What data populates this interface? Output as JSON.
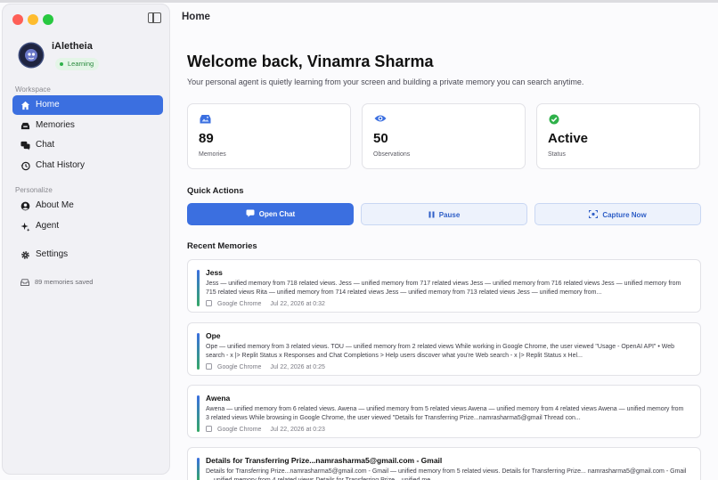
{
  "sidebar": {
    "app_name": "iAletheia",
    "status": "Learning",
    "workspace_label": "Workspace",
    "personalize_label": "Personalize",
    "workspace_items": [
      {
        "label": "Home",
        "icon": "home-icon"
      },
      {
        "label": "Memories",
        "icon": "tray-icon"
      },
      {
        "label": "Chat",
        "icon": "chat-bubbles-icon"
      },
      {
        "label": "Chat History",
        "icon": "history-clock-icon"
      }
    ],
    "personalize_items": [
      {
        "label": "About Me",
        "icon": "person-circle-icon"
      },
      {
        "label": "Agent",
        "icon": "sparkle-icon"
      }
    ],
    "settings_label": "Settings",
    "memories_saved": "89 memories saved"
  },
  "header": {
    "title": "Home"
  },
  "main": {
    "welcome": "Welcome back, Vinamra Sharma",
    "subtitle": "Your personal agent is quietly learning from your screen and building a private memory you can search anytime.",
    "stats": [
      {
        "value": "89",
        "label": "Memories",
        "icon": "photo-tray-icon",
        "color": "#3b6fe0"
      },
      {
        "value": "50",
        "label": "Observations",
        "icon": "eye-icon",
        "color": "#3b6fe0"
      },
      {
        "value": "Active",
        "label": "Status",
        "icon": "checkmark-circle-icon",
        "color": "#2fb14a"
      }
    ],
    "quick_actions_label": "Quick Actions",
    "actions": [
      {
        "label": "Open Chat",
        "icon": "chat-icon"
      },
      {
        "label": "Pause",
        "icon": "pause-icon"
      },
      {
        "label": "Capture Now",
        "icon": "capture-icon"
      }
    ],
    "recent_memories_label": "Recent Memories",
    "memories": [
      {
        "title": "Jess",
        "body": "Jess — unified memory from 718 related views. Jess — unified memory from 717 related views Jess — unified memory from 716 related views Jess — unified memory from 715 related views Rita — unified memory from 714 related views Jess — unified memory from 713 related views Jess — unified memory from...",
        "app": "Google Chrome",
        "date": "Jul 22, 2026 at 0:32"
      },
      {
        "title": "Ope",
        "body": "Ope — unified memory from 3 related views. TOU — unified memory from 2 related views While working in Google Chrome, the user viewed \"Usage - OpenAI API\" • Web search - x |> Replit Status x Responses and Chat Completions > Help users discover what you're Web search - x |> Replit Status x Hel...",
        "app": "Google Chrome",
        "date": "Jul 22, 2026 at 0:25"
      },
      {
        "title": "Awena",
        "body": "Awena — unified memory from 6 related views. Awena — unified memory from 5 related views Awena — unified memory from 4 related views Awena — unified memory from 3 related views While browsing in Google Chrome, the user viewed \"Details for Transferring Prize...namrasharma5@gmail Thread con...",
        "app": "Google Chrome",
        "date": "Jul 22, 2026 at 0:23"
      },
      {
        "title": "Details for Transferring Prize...namrasharma5@gmail.com - Gmail",
        "body": "Details for Transferring Prize...namrasharma5@gmail.com - Gmail — unified memory from 5 related views. Details for Transferring Prize... namrasharma5@gmail.com - Gmail — unified memory from 4 related views Details for Transferring Prize... unified me...",
        "app": "",
        "date": ""
      }
    ]
  },
  "colors": {
    "accent": "#3b6fe0",
    "success": "#2fb14a"
  }
}
